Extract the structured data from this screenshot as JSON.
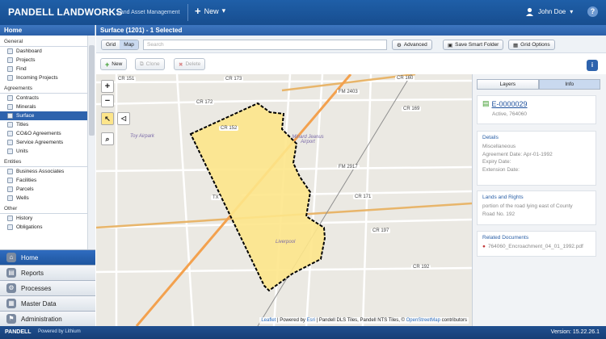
{
  "app": {
    "brand": "PANDELL LANDWORKS",
    "subtitle": "Land Asset Management",
    "new_label": "New",
    "user_name": "John Doe"
  },
  "left_panel": {
    "title": "Home",
    "sections": [
      {
        "label": "General",
        "items": [
          "Dashboard",
          "Projects",
          "Find",
          "Incoming Projects"
        ]
      },
      {
        "label": "Agreements",
        "items": [
          "Contracts",
          "Minerals",
          "Surface",
          "Titles",
          "CO&O Agreements",
          "Service Agreements",
          "Units"
        ]
      },
      {
        "label": "Entities",
        "items": [
          "Business Associates",
          "Facilities",
          "Parcels",
          "Wells"
        ]
      },
      {
        "label": "Other",
        "items": [
          "History",
          "Obligations"
        ]
      }
    ],
    "selected_item": "Surface",
    "bottom_buttons": [
      "Home",
      "Reports",
      "Processes",
      "Master Data",
      "Administration"
    ]
  },
  "main": {
    "title": "Surface (1201) - 1 Selected",
    "view_grid": "Grid",
    "view_map": "Map",
    "search_placeholder": "Search",
    "advanced_label": "Advanced",
    "save_smart_folder_label": "Save Smart Folder",
    "grid_options_label": "Grid Options",
    "actions": {
      "new": "New",
      "clone": "Clone",
      "delete": "Delete"
    }
  },
  "map": {
    "roads": [
      "CR 151",
      "CR 173",
      "CR 160",
      "CR 172",
      "CR 169",
      "FM 2403",
      "CR 152",
      "FM 2917",
      "CR 171",
      "CR 197",
      "CR 192",
      "TX"
    ],
    "places": [
      "Toy Airpark",
      "Minard Jeanus Airport",
      "Liverpool"
    ],
    "attribution_parts": [
      "Leaflet",
      " | Powered by ",
      "Esri",
      " | Pandell DLS Tiles, Pandell NTS Tiles, © ",
      "OpenStreetMap",
      " contributors"
    ]
  },
  "info_panel": {
    "tabs": [
      "Layers",
      "Info"
    ],
    "record_id": "E-0000029",
    "record_status": "Active, 764060",
    "details_title": "Details",
    "details_lines": [
      "Miscellaneous",
      "Agreement Date: Apr-01-1992",
      "Expiry Date:",
      "Extension Date:"
    ],
    "lands_title": "Lands and Rights",
    "lands_text": "portion of the road lying east of County Road No. 192",
    "docs_title": "Related Documents",
    "doc_name": "764060_Encroachment_04_01_1992.pdf"
  },
  "footer": {
    "brand": "PANDELL",
    "powered": "Powered by Lithium",
    "version": "Version: 15.22.26.1"
  },
  "colors": {
    "header_blue": "#1f5fa8",
    "selected_blue": "#2e63ad",
    "parcel_fill": "#fde58a",
    "parcel_border": "#000000"
  }
}
